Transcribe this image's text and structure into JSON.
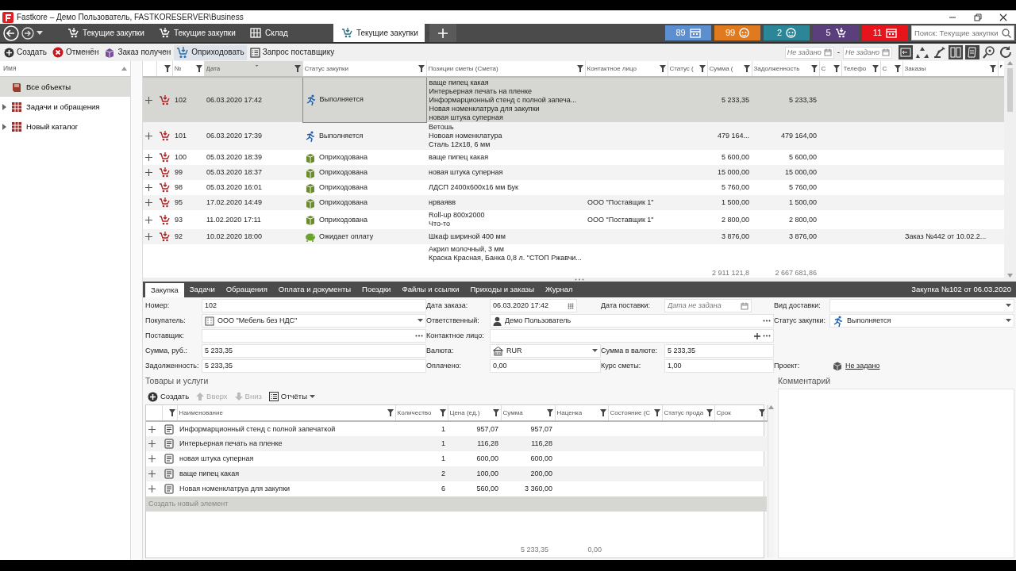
{
  "window": {
    "title": "Fastkore – Демо Пользователь, FASTKORESERVER\\Business"
  },
  "nav_tabs": [
    {
      "label": "Текущие закупки",
      "kind": "cart",
      "selected": false
    },
    {
      "label": "Текущие закупки",
      "kind": "cart",
      "selected": false
    },
    {
      "label": "Склад",
      "kind": "warehouse",
      "selected": false
    },
    {
      "label": "Текущие закупки",
      "kind": "cart",
      "selected": true
    }
  ],
  "counters": [
    {
      "count": "89",
      "kind": "calendar",
      "color": "#5b8fd0"
    },
    {
      "count": "99",
      "kind": "face",
      "color": "#e07a1f"
    },
    {
      "count": "2",
      "kind": "face",
      "color": "#2b8797"
    },
    {
      "count": "5",
      "kind": "cart",
      "color": "#5b3f7d"
    },
    {
      "count": "11",
      "kind": "calendar",
      "color": "#e8141c"
    }
  ],
  "search": {
    "placeholder": "Поиск: Текущие закупки"
  },
  "toolbar": [
    {
      "label": "Создать",
      "kind": "create",
      "hovered": false
    },
    {
      "label": "Отменён",
      "kind": "cancel",
      "hovered": false
    },
    {
      "label": "Заказ получен",
      "kind": "received",
      "hovered": false
    },
    {
      "label": "Оприходовать",
      "kind": "post",
      "hovered": true
    },
    {
      "label": "Запрос поставщику",
      "kind": "request",
      "hovered": false
    }
  ],
  "date_filter": {
    "from_placeholder": "Не задано",
    "separator": "-",
    "to_placeholder": "Не задано"
  },
  "sidebar": {
    "header": "Имя",
    "items": [
      {
        "label": "Все объекты",
        "kind": "root",
        "selected": true
      },
      {
        "label": "Задачи и обращения",
        "kind": "catalog",
        "selected": false,
        "expanded": false
      },
      {
        "label": "Новый каталог",
        "kind": "catalog",
        "selected": false,
        "expanded": false
      }
    ]
  },
  "grid": {
    "columns": [
      {
        "label": "№",
        "sorted": false
      },
      {
        "label": "Дата",
        "sorted": true
      },
      {
        "label": "Статус закупки",
        "sorted": false
      },
      {
        "label": "Позиции сметы (Смета)",
        "sorted": false
      },
      {
        "label": "Контактное лицо",
        "sorted": false
      },
      {
        "label": "Статус (",
        "sorted": false
      },
      {
        "label": "Сумма (",
        "sorted": false
      },
      {
        "label": "Задолженность",
        "sorted": false
      },
      {
        "label": "С",
        "sorted": false
      },
      {
        "label": "Телефо",
        "sorted": false
      },
      {
        "label": "С",
        "sorted": false
      },
      {
        "label": "Заказы",
        "sorted": false
      }
    ],
    "rows": [
      {
        "kind": "order",
        "selected": true,
        "number": "102",
        "date": "06.03.2020 17:42",
        "status": {
          "label": "Выполняется",
          "kind": "running"
        },
        "positions": [
          "ваще пипец какая",
          "Интерьерная печать на пленке",
          "Информарционный стенд с полной запеча...",
          "Новая номенклатруа для закупки",
          "новая штука суперная"
        ],
        "sum": "5 233,35",
        "debt": "5 233,35"
      },
      {
        "kind": "order",
        "selected": false,
        "number": "101",
        "date": "06.03.2020 17:39",
        "status": {
          "label": "Выполняется",
          "kind": "running"
        },
        "positions": [
          "Ветошь",
          "Новоая номенклатура",
          "Сталь 12x18, 6 мм"
        ],
        "sum": "479 164...",
        "debt": "479 164,00"
      },
      {
        "kind": "order",
        "selected": false,
        "number": "100",
        "date": "05.03.2020 18:39",
        "status": {
          "label": "Оприходована",
          "kind": "posted"
        },
        "positions": [
          "ваще пипец какая"
        ],
        "sum": "5 600,00",
        "debt": "5 600,00"
      },
      {
        "kind": "order",
        "selected": false,
        "number": "99",
        "date": "05.03.2020 18:37",
        "status": {
          "label": "Оприходована",
          "kind": "posted"
        },
        "positions": [
          "новая штука суперная"
        ],
        "sum": "15 000,00",
        "debt": "15 000,00"
      },
      {
        "kind": "order",
        "selected": false,
        "number": "98",
        "date": "05.03.2020 16:01",
        "status": {
          "label": "Оприходована",
          "kind": "posted"
        },
        "positions": [
          "ЛДСП 2400x600x16 мм Бук"
        ],
        "sum": "5 760,00",
        "debt": "5 760,00"
      },
      {
        "kind": "order",
        "selected": false,
        "number": "95",
        "date": "17.02.2020 14:49",
        "status": {
          "label": "Оприходована",
          "kind": "posted"
        },
        "positions": [
          "нрваявв"
        ],
        "contact": "ООО \"Поставщик 1\"",
        "sum": "1 500,00",
        "debt": "1 500,00"
      },
      {
        "kind": "order",
        "selected": false,
        "number": "93",
        "date": "11.02.2020 17:11",
        "status": {
          "label": "Оприходована",
          "kind": "posted"
        },
        "positions": [
          "Roll-up 800x2000",
          "Что-то"
        ],
        "contact": "ООО \"Поставщик 1\"",
        "sum": "2 800,00",
        "debt": "2 800,00"
      },
      {
        "kind": "order",
        "selected": false,
        "number": "92",
        "date": "10.02.2020 18:00",
        "status": {
          "label": "Ожидает оплату",
          "kind": "awaiting"
        },
        "positions": [
          "Шкаф шириной 400 мм"
        ],
        "sum": "3 876,00",
        "debt": "3 876,00",
        "orders": "Заказ №442 от 10.02.2..."
      },
      {
        "kind": "partial",
        "selected": false,
        "positions": [
          "Акрил молочный, 3 мм",
          "Краска Красная, Банка 0,8 л. \"СТОП Ржавчи..."
        ]
      }
    ],
    "totals": {
      "sum": "2 911 121,8",
      "debt": "2 667 681,86"
    }
  },
  "detail": {
    "tabs": [
      {
        "label": "Закупка",
        "selected": true
      },
      {
        "label": "Задачи",
        "selected": false
      },
      {
        "label": "Обращения",
        "selected": false
      },
      {
        "label": "Оплата и документы",
        "selected": false
      },
      {
        "label": "Поездки",
        "selected": false
      },
      {
        "label": "Файлы и ссылки",
        "selected": false
      },
      {
        "label": "Приходы и заказы",
        "selected": false
      },
      {
        "label": "Журнал",
        "selected": false
      }
    ],
    "title": "Закупка №102 от 06.03.2020",
    "form_rows": [
      [
        {
          "label": "Номер:",
          "kind": "text",
          "value": "102"
        },
        {
          "label": "Дата заказа:",
          "kind": "date",
          "value": "06.03.2020 17:42"
        },
        {
          "label": "Дата поставки:",
          "kind": "date",
          "placeholder": "Дата не задана"
        },
        {
          "label": "Вид доставки:",
          "kind": "select"
        }
      ],
      [
        {
          "label": "Покупатель:",
          "kind": "company-select",
          "value": "ООО \"Мебель без НДС\""
        },
        {
          "label": "Ответственный:",
          "kind": "person-lookup",
          "value": "Демо Пользователь"
        },
        {
          "label": "Статус закупки:",
          "kind": "status-select",
          "value": "Выполняется"
        }
      ],
      [
        {
          "label": "Поставщик:",
          "kind": "lookup"
        },
        {
          "label": "Контактное лицо:",
          "kind": "contact-lookup"
        }
      ],
      [
        {
          "label": "Сумма, руб.:",
          "kind": "text",
          "value": "5 233,35"
        },
        {
          "label": "Валюта:",
          "kind": "currency-select",
          "value": "RUR"
        },
        {
          "label": "Сумма в валюте:",
          "kind": "text",
          "value": "5 233,35"
        }
      ],
      [
        {
          "label": "Задолженность:",
          "kind": "text",
          "value": "5 233,35"
        },
        {
          "label": "Оплачено:",
          "kind": "text",
          "value": "0,00"
        },
        {
          "label": "Курс сметы:",
          "kind": "text",
          "value": "1,00"
        },
        {
          "label": "Проект:",
          "kind": "link",
          "value": "Не задано"
        }
      ]
    ],
    "goods": {
      "title": "Товары и услуги",
      "toolbar": [
        {
          "label": "Создать",
          "kind": "create",
          "disabled": false
        },
        {
          "label": "Вверх",
          "kind": "up",
          "disabled": true
        },
        {
          "label": "Вниз",
          "kind": "down",
          "disabled": true
        },
        {
          "label": "Отчёты",
          "kind": "reports",
          "disabled": false
        }
      ],
      "columns": [
        "Наименование",
        "Количество",
        "Цена (ед.)",
        "Сумма",
        "Наценка",
        "Состояние (С",
        "Статус прода",
        "Срок"
      ],
      "rows": [
        {
          "name": "Информарционный стенд с полной запечаткой",
          "quantity": "1",
          "price": "957,07",
          "sum": "957,07"
        },
        {
          "name": "Интерьерная печать на пленке",
          "quantity": "1",
          "price": "116,28",
          "sum": "116,28"
        },
        {
          "name": "новая штука суперная",
          "quantity": "1",
          "price": "600,00",
          "sum": "600,00"
        },
        {
          "name": "ваще пипец какая",
          "quantity": "2",
          "price": "100,00",
          "sum": "200,00"
        },
        {
          "name": "Новая номенклатруа для закупки",
          "quantity": "6",
          "price": "560,00",
          "sum": "3 360,00"
        }
      ],
      "new_row": "Создать новый элемент",
      "totals": {
        "sum": "5 233,35",
        "markup": "0,00"
      }
    },
    "comment": {
      "label": "Комментарий"
    }
  }
}
